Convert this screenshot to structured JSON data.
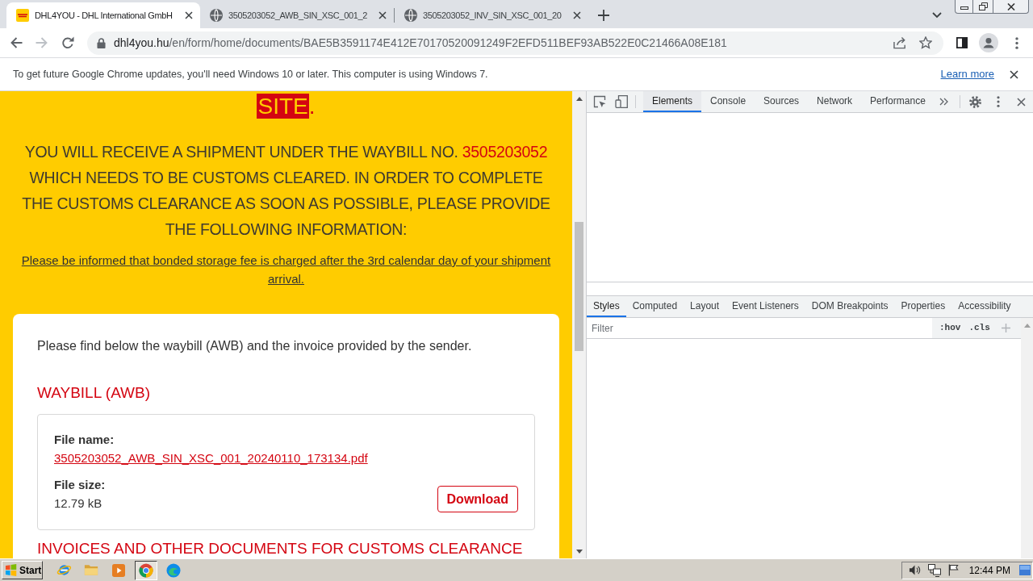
{
  "browser": {
    "tabs": [
      {
        "kind": "logo",
        "title": "DHL4YOU - DHL International GmbH",
        "selected": true
      },
      {
        "kind": "globe",
        "title": "3505203052_AWB_SIN_XSC_001_2",
        "selected": false
      },
      {
        "kind": "globe",
        "title": "3505203052_INV_SIN_XSC_001_20",
        "selected": false
      }
    ],
    "nav_buttons": [
      {
        "kind": "back",
        "disabled": false
      },
      {
        "kind": "forward",
        "disabled": true
      },
      {
        "kind": "reload",
        "disabled": false
      }
    ],
    "address_bar": {
      "host": "dhl4you.hu",
      "path": "/en/form/home/documents/BAE5B3591174E412E70170520091249F2EFD511BEF93AB522E0C21466A08E181"
    }
  },
  "info_bar": {
    "message": "To get future Google Chrome updates, you'll need Windows 10 or later. This computer is using Windows 7.",
    "link": "Learn more"
  },
  "page": {
    "heading_end": [
      {
        "text": "SITE",
        "highlighted": true
      },
      {
        "text": ".",
        "highlighted": false
      }
    ],
    "instructions": [
      {
        "text": "YOU WILL RECEIVE A SHIPMENT UNDER THE WAYBILL NO. ",
        "highlighted": false
      },
      {
        "text": "3505203052",
        "highlighted": true
      },
      {
        "text": " WHICH NEEDS TO BE CUSTOMS CLEARED. IN ORDER TO COMPLETE THE CUSTOMS CLEARANCE AS SOON AS POSSIBLE, PLEASE PROVIDE THE FOLLOWING INFORMATION:",
        "highlighted": false
      }
    ],
    "notice": "Please be informed that bonded storage fee is charged after the 3rd calendar day of your shipment arrival.",
    "card": {
      "intro": "Please find below the waybill (AWB) and the invoice provided by the sender.",
      "sections": [
        {
          "heading": "WAYBILL (AWB)",
          "file": {
            "name_label": "File name:",
            "name": "3505203052_AWB_SIN_XSC_001_20240110_173134.pdf",
            "size_label": "File size:",
            "size": "12.79 kB",
            "button": "Download"
          }
        },
        {
          "heading": "INVOICES AND OTHER DOCUMENTS FOR CUSTOMS CLEARANCE"
        }
      ]
    }
  },
  "devtools": {
    "tabs": [
      {
        "label": "Elements",
        "selected": true
      },
      {
        "label": "Console",
        "selected": false
      },
      {
        "label": "Sources",
        "selected": false
      },
      {
        "label": "Network",
        "selected": false
      },
      {
        "label": "Performance",
        "selected": false
      }
    ],
    "sidebar_tabs": [
      {
        "label": "Styles",
        "selected": true
      },
      {
        "label": "Computed",
        "selected": false
      },
      {
        "label": "Layout",
        "selected": false
      },
      {
        "label": "Event Listeners",
        "selected": false
      },
      {
        "label": "DOM Breakpoints",
        "selected": false
      },
      {
        "label": "Properties",
        "selected": false
      },
      {
        "label": "Accessibility",
        "selected": false
      }
    ],
    "filter": {
      "placeholder": "Filter",
      "toggles": [
        ":hov",
        ".cls"
      ]
    }
  },
  "taskbar": {
    "start": "Start",
    "apps": [
      {
        "kind": "ie",
        "selected": false
      },
      {
        "kind": "explorer",
        "selected": false
      },
      {
        "kind": "media",
        "selected": false
      },
      {
        "kind": "chrome",
        "selected": true
      },
      {
        "kind": "edge",
        "selected": false
      }
    ],
    "clock": "12:44 PM"
  }
}
